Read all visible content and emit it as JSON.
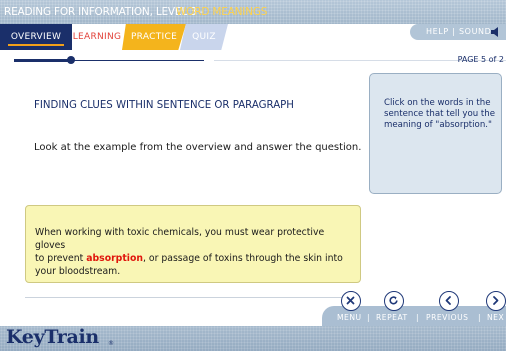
{
  "header": {
    "title_prefix": "READING FOR INFORMATION, LEVEL 3 - ",
    "title_topic": "WORD MEANINGS"
  },
  "tabs": [
    {
      "label": "OVERVIEW",
      "active": true
    },
    {
      "label": "LEARNING"
    },
    {
      "label": "PRACTICE"
    },
    {
      "label": "QUIZ"
    }
  ],
  "utility": {
    "help": "HELP",
    "separator": "|",
    "sound": "SOUND"
  },
  "progress": {
    "page_label": "PAGE 5 of 2",
    "fraction": 0.3
  },
  "main": {
    "heading": "FINDING CLUES WITHIN SENTENCE OR PARAGRAPH",
    "instruction": "Look at the example from the overview and answer the question."
  },
  "prompt": {
    "text": "Click on the words in the sentence that tell you the meaning of \"absorption.\""
  },
  "sentence": {
    "line1": "When working with toxic chemicals, you must wear protective gloves",
    "line2_before": "to prevent ",
    "highlight": "absorption",
    "line2_after": ", or passage of toxins through the skin into",
    "line3": "your bloodstream."
  },
  "nav": {
    "menu": "MENU",
    "repeat": "REPEAT",
    "previous": "PREVIOUS",
    "next": "NEX",
    "separator": "|"
  },
  "footer": {
    "brand": "KeyTrain",
    "registered": "®"
  },
  "colors": {
    "navy": "#1a2f6a",
    "orange": "#f4b41c",
    "highlight_red": "#e0160c",
    "note_yellow": "#f9f6b5"
  }
}
